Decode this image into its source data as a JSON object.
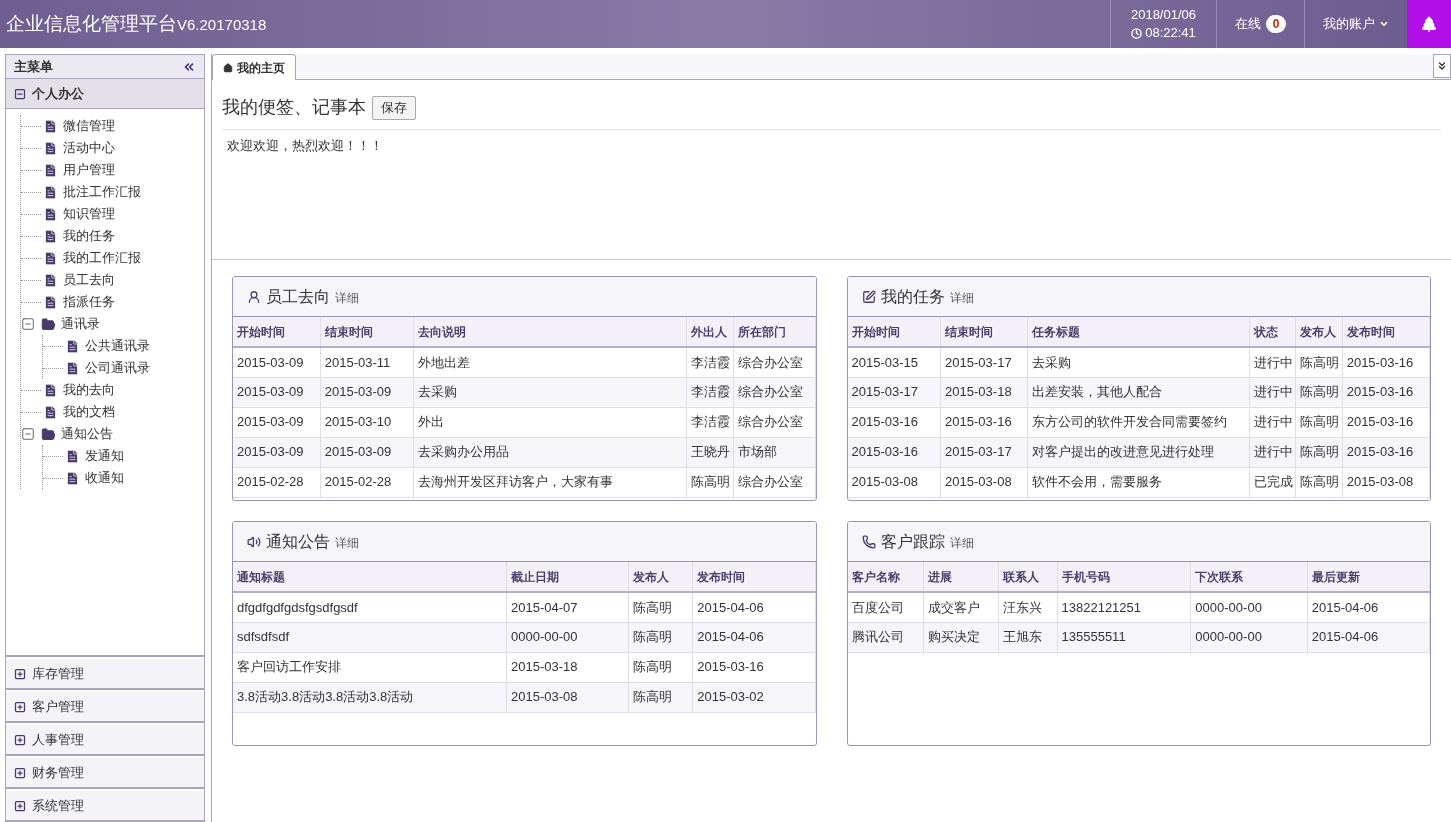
{
  "header": {
    "title": "企业信息化管理平台",
    "version": "V6.20170318",
    "date": "2018/01/06",
    "time": "08:22:41",
    "online_label": "在线",
    "online_count": "0",
    "account_label": "我的账户"
  },
  "sidebar": {
    "title": "主菜单",
    "sections": [
      {
        "label": "个人办公",
        "expanded": true,
        "items": [
          {
            "label": "微信管理",
            "kind": "file"
          },
          {
            "label": "活动中心",
            "kind": "file"
          },
          {
            "label": "用户管理",
            "kind": "file"
          },
          {
            "label": "批注工作汇报",
            "kind": "file"
          },
          {
            "label": "知识管理",
            "kind": "file"
          },
          {
            "label": "我的任务",
            "kind": "file"
          },
          {
            "label": "我的工作汇报",
            "kind": "file"
          },
          {
            "label": "员工去向",
            "kind": "file"
          },
          {
            "label": "指派任务",
            "kind": "file"
          },
          {
            "label": "通讯录",
            "kind": "folder",
            "expanded": true,
            "children": [
              {
                "label": "公共通讯录",
                "kind": "file"
              },
              {
                "label": "公司通讯录",
                "kind": "file"
              }
            ]
          },
          {
            "label": "我的去向",
            "kind": "file"
          },
          {
            "label": "我的文档",
            "kind": "file"
          },
          {
            "label": "通知公告",
            "kind": "folder",
            "expanded": true,
            "children": [
              {
                "label": "发通知",
                "kind": "file"
              },
              {
                "label": "收通知",
                "kind": "file"
              }
            ]
          }
        ]
      },
      {
        "label": "库存管理",
        "expanded": false
      },
      {
        "label": "客户管理",
        "expanded": false
      },
      {
        "label": "人事管理",
        "expanded": false
      },
      {
        "label": "财务管理",
        "expanded": false
      },
      {
        "label": "系统管理",
        "expanded": false
      }
    ]
  },
  "tabs": [
    {
      "label": "我的主页",
      "selected": true
    }
  ],
  "notepad": {
    "title": "我的便签、记事本",
    "save_button": "保存",
    "content": "欢迎欢迎，热烈欢迎！！！"
  },
  "panels": [
    {
      "title": "员工去向",
      "detail": "详细",
      "kind": "user",
      "columns": [
        "开始时间",
        "结束时间",
        "去向说明",
        "外出人",
        "所在部门"
      ],
      "rows": [
        [
          "2015-03-09",
          "2015-03-11",
          "外地出差",
          "李洁霞",
          "综合办公室"
        ],
        [
          "2015-03-09",
          "2015-03-09",
          "去采购",
          "李洁霞",
          "综合办公室"
        ],
        [
          "2015-03-09",
          "2015-03-10",
          "外出",
          "李洁霞",
          "综合办公室"
        ],
        [
          "2015-03-09",
          "2015-03-09",
          "去采购办公用品",
          "王晓丹",
          "市场部"
        ],
        [
          "2015-02-28",
          "2015-02-28",
          "去海州开发区拜访客户，大家有事",
          "陈高明",
          "综合办公室"
        ]
      ]
    },
    {
      "title": "我的任务",
      "detail": "详细",
      "kind": "edit",
      "columns": [
        "开始时间",
        "结束时间",
        "任务标题",
        "状态",
        "发布人",
        "发布时间"
      ],
      "rows": [
        [
          "2015-03-15",
          "2015-03-17",
          "去采购",
          "进行中",
          "陈高明",
          "2015-03-16"
        ],
        [
          "2015-03-17",
          "2015-03-18",
          "出差安装，其他人配合",
          "进行中",
          "陈高明",
          "2015-03-16"
        ],
        [
          "2015-03-16",
          "2015-03-16",
          "东方公司的软件开发合同需要签约",
          "进行中",
          "陈高明",
          "2015-03-16"
        ],
        [
          "2015-03-16",
          "2015-03-17",
          "对客户提出的改进意见进行处理",
          "进行中",
          "陈高明",
          "2015-03-16"
        ],
        [
          "2015-03-08",
          "2015-03-08",
          "软件不会用，需要服务",
          "已完成",
          "陈高明",
          "2015-03-08"
        ]
      ]
    },
    {
      "title": "通知公告",
      "detail": "详细",
      "kind": "speaker",
      "columns": [
        "通知标题",
        "截止日期",
        "发布人",
        "发布时间"
      ],
      "rows": [
        [
          "dfgdfgdfgdsfgsdfgsdf",
          "2015-04-07",
          "陈高明",
          "2015-04-06"
        ],
        [
          "sdfsdfsdf",
          "0000-00-00",
          "陈高明",
          "2015-04-06"
        ],
        [
          "客户回访工作安排",
          "2015-03-18",
          "陈高明",
          "2015-03-16"
        ],
        [
          "3.8活动3.8活动3.8活动3.8活动",
          "2015-03-08",
          "陈高明",
          "2015-03-02"
        ]
      ]
    },
    {
      "title": "客户跟踪",
      "detail": "详细",
      "kind": "phone",
      "columns": [
        "客户名称",
        "进展",
        "联系人",
        "手机号码",
        "下次联系",
        "最后更新"
      ],
      "rows": [
        [
          "百度公司",
          "成交客户",
          "汪东兴",
          "13822121251",
          "0000-00-00",
          "2015-04-06"
        ],
        [
          "腾讯公司",
          "购买决定",
          "王旭东",
          "135555511",
          "0000-00-00",
          "2015-04-06"
        ]
      ]
    }
  ]
}
